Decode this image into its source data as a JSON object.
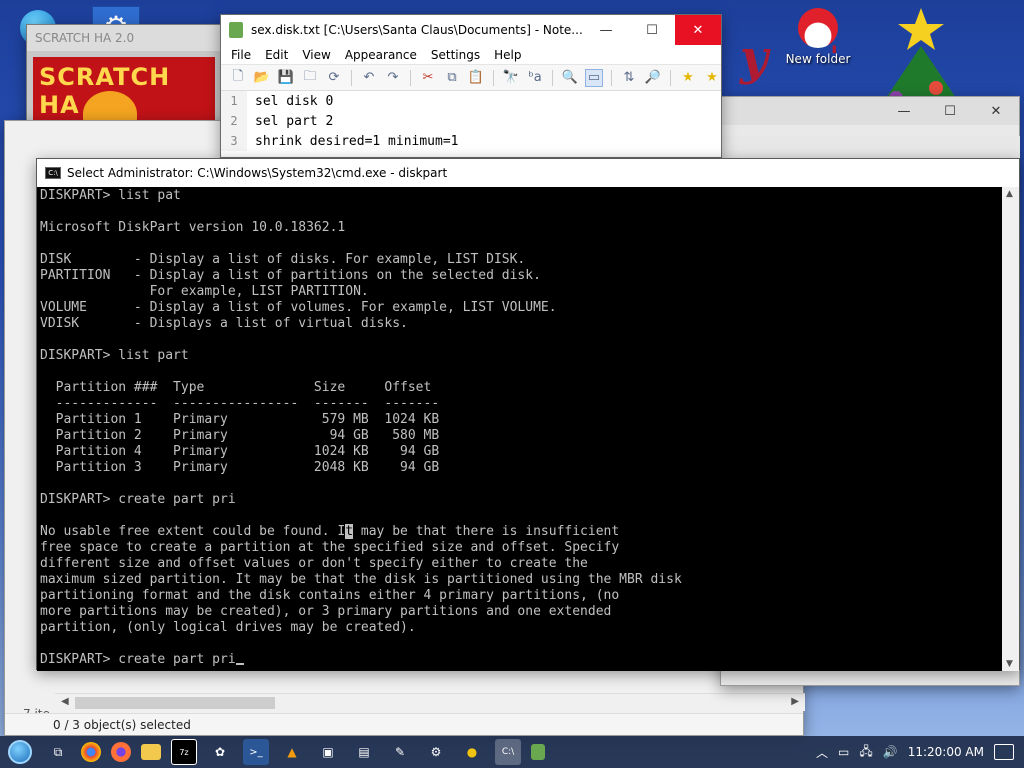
{
  "desktop": {
    "new_folder_label": "New folder"
  },
  "scratch": {
    "title": "SCRATCH HA 2.0",
    "banner": "SCRATCH HA"
  },
  "explorer": {
    "status": "0 / 3 object(s) selected",
    "items": "7 ite"
  },
  "notepad": {
    "title": "sex.disk.txt [C:\\Users\\Santa Claus\\Documents] - Note...",
    "menu": [
      "File",
      "Edit",
      "View",
      "Appearance",
      "Settings",
      "Help"
    ],
    "lines": [
      {
        "n": "1",
        "text": "sel disk 0"
      },
      {
        "n": "2",
        "text": "sel part 2"
      },
      {
        "n": "3",
        "text": "shrink desired=1 minimum=1"
      }
    ]
  },
  "cmd": {
    "title": "Select Administrator: C:\\Windows\\System32\\cmd.exe - diskpart",
    "before_selection": "DISKPART> list pat\n\nMicrosoft DiskPart version 10.0.18362.1\n\nDISK        - Display a list of disks. For example, LIST DISK.\nPARTITION   - Display a list of partitions on the selected disk.\n              For example, LIST PARTITION.\nVOLUME      - Display a list of volumes. For example, LIST VOLUME.\nVDISK       - Displays a list of virtual disks.\n\nDISKPART> list part\n\n  Partition ###  Type              Size     Offset\n  -------------  ----------------  -------  -------\n  Partition 1    Primary            579 MB  1024 KB\n  Partition 2    Primary             94 GB   580 MB\n  Partition 4    Primary           1024 KB    94 GB\n  Partition 3    Primary           2048 KB    94 GB\n\nDISKPART> create part pri\n\nNo usable free extent could be found. I",
    "selected": "t",
    "after_selection": " may be that there is insufficient\nfree space to create a partition at the specified size and offset. Specify\ndifferent size and offset values or don't specify either to create the\nmaximum sized partition. It may be that the disk is partitioned using the MBR disk\npartitioning format and the disk contains either 4 primary partitions, (no\nmore partitions may be created), or 3 primary partitions and one extended\npartition, (only logical drives may be created).\n\nDISKPART> create part pri"
  },
  "taskbar": {
    "clock": "11:20:00 AM"
  },
  "colors": {
    "close_red": "#e81123",
    "console_bg": "#000000",
    "console_fg": "#c0c0c0"
  }
}
